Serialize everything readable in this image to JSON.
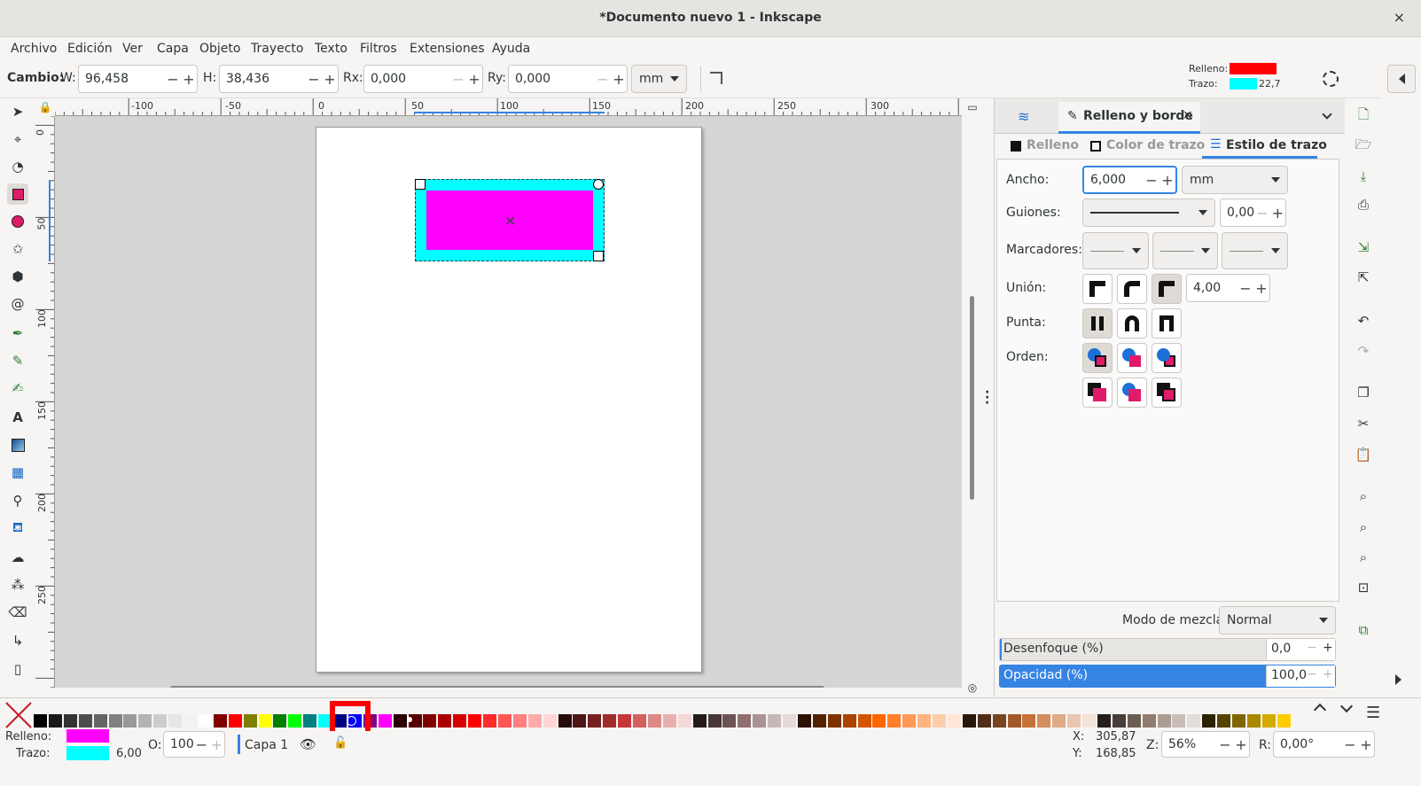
{
  "window": {
    "title": "*Documento nuevo 1 - Inkscape",
    "close": "×"
  },
  "menu": [
    "Archivo",
    "Edición",
    "Ver",
    "Capa",
    "Objeto",
    "Trayecto",
    "Texto",
    "Filtros",
    "Extensiones",
    "Ayuda"
  ],
  "toolctl": {
    "label": "Cambio:",
    "w_label": "W:",
    "w": "96,458",
    "h_label": "H:",
    "h": "38,436",
    "rx_label": "Rx:",
    "rx": "0,000",
    "ry_label": "Ry:",
    "ry": "0,000",
    "unit": "mm",
    "fill_label": "Relleno:",
    "stroke_label": "Trazo:",
    "stroke_width": "22,7"
  },
  "ruler_h": [
    "-100",
    "-50",
    "0",
    "50",
    "100",
    "150",
    "200",
    "250",
    "300"
  ],
  "ruler_v": [
    "0",
    "50",
    "100",
    "150",
    "200",
    "250"
  ],
  "colors": {
    "fill": "#ff00ff",
    "stroke": "#00ffff",
    "toolfill": "#ff0000",
    "accent": "#3584e4"
  },
  "dock": {
    "tab_title": "Relleno y borde",
    "subtabs": [
      "Relleno",
      "Color de trazo",
      "Estilo de trazo"
    ],
    "ancho_label": "Ancho:",
    "ancho": "6,000",
    "ancho_unit": "mm",
    "guiones_label": "Guiones:",
    "guiones": "0,00",
    "marcadores_label": "Marcadores:",
    "union_label": "Unión:",
    "union": "4,00",
    "punta_label": "Punta:",
    "orden_label": "Orden:",
    "blend_label": "Modo de mezcla:",
    "blend": "Normal",
    "blur_label": "Desenfoque (%)",
    "blur": "0,0",
    "opacity_label": "Opacidad (%)",
    "opacity": "100,0"
  },
  "status": {
    "fill_label": "Relleno:",
    "stroke_label": "Trazo:",
    "stroke_width": "6,00",
    "o_label": "O:",
    "o": "100",
    "layer": "Capa 1",
    "x_label": "X:",
    "x": "305,87",
    "y_label": "Y:",
    "y": "168,85",
    "z_label": "Z:",
    "zoom": "56%",
    "r_label": "R:",
    "rotation": "0,00°"
  },
  "palette": [
    "#000000",
    "#1a1a1a",
    "#333333",
    "#4d4d4d",
    "#666666",
    "#808080",
    "#999999",
    "#b3b3b3",
    "#cccccc",
    "#e6e6e6",
    "#f2f2f2",
    "#ffffff",
    "#800000",
    "#ff0000",
    "#808000",
    "#ffff00",
    "#008000",
    "#00ff00",
    "#008080",
    "#00ffff",
    "#000080",
    "#0000ff",
    "#800080",
    "#ff00ff",
    "#2b0000",
    "#550000",
    "#800000",
    "#aa0000",
    "#d40000",
    "#ff0000",
    "#ff2a2a",
    "#ff5555",
    "#ff8080",
    "#ffaaaa",
    "#ffd5d5",
    "#280b0b",
    "#501616",
    "#782121",
    "#a02c2c",
    "#c83737",
    "#d35f5f",
    "#de8787",
    "#e9afaf",
    "#f4d7d7",
    "#241c1c",
    "#483737",
    "#6c5353",
    "#916f6f",
    "#ac9393",
    "#c8b7b7",
    "#e3dbdb",
    "#2b1100",
    "#552200",
    "#803300",
    "#aa4400",
    "#d45500",
    "#ff6600",
    "#ff7f2a",
    "#ff9955",
    "#ffb380",
    "#ffccaa",
    "#ffe6d5",
    "#28170b",
    "#502d16",
    "#784421",
    "#a05a2c",
    "#c87137",
    "#d38d5f",
    "#deaa87",
    "#e9c6af",
    "#f4e3d7",
    "#241f1c",
    "#483e37",
    "#6c5d53",
    "#917c6f",
    "#ac9d93",
    "#c8beb7",
    "#e3dedb",
    "#2b2200",
    "#554400",
    "#806600",
    "#aa8800",
    "#d4aa00",
    "#ffcc00"
  ]
}
